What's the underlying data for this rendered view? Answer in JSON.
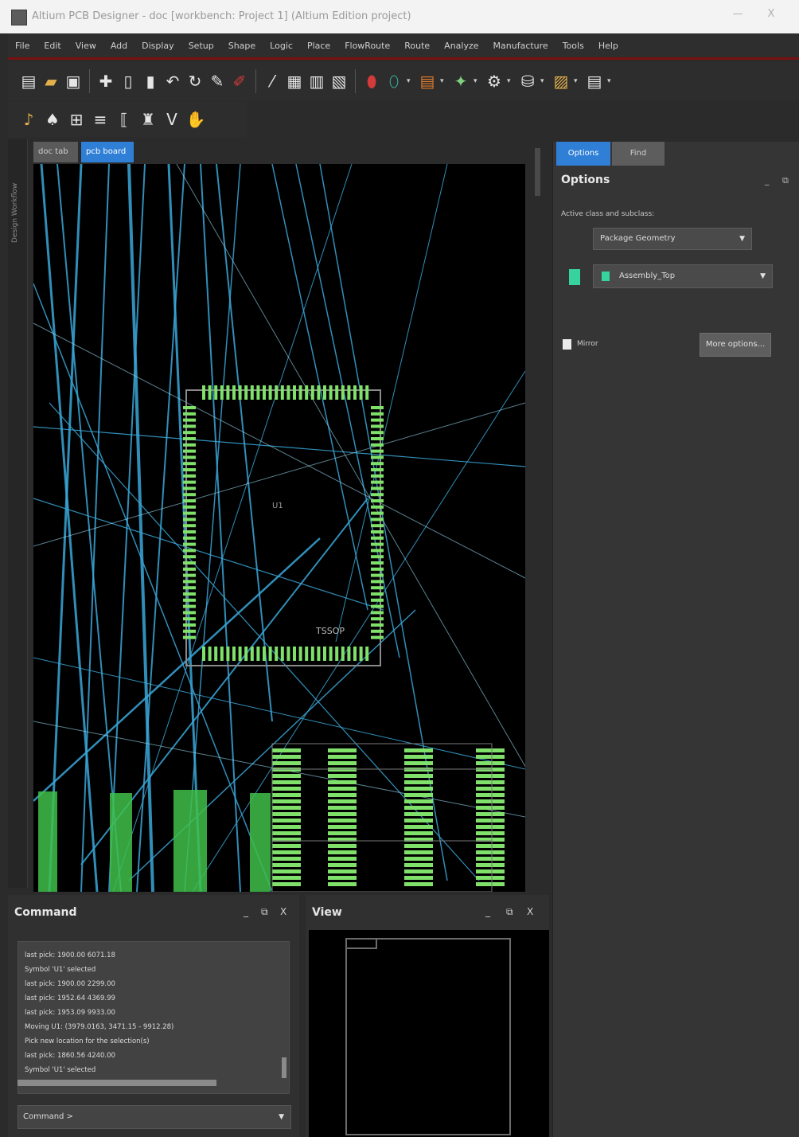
{
  "window": {
    "title": "Altium PCB Designer - doc [workbench: Project 1] (Altium Edition project)",
    "minimize": "—",
    "close": "X"
  },
  "menu": [
    "File",
    "Edit",
    "View",
    "Add",
    "Display",
    "Setup",
    "Shape",
    "Logic",
    "Place",
    "FlowRoute",
    "Route",
    "Analyze",
    "Manufacture",
    "Tools",
    "Help"
  ],
  "icons": {
    "toolbar1": [
      "new-file-icon",
      "open-folder-icon",
      "save-icon",
      "add-icon",
      "copy-icon",
      "delete-icon",
      "undo-icon",
      "redo-icon",
      "probe-icon",
      "probe2-icon",
      "route-icon",
      "component-icon",
      "library-icon",
      "footprint-icon",
      "red-net-icon",
      "teal-net-icon",
      "layer-stack-icon",
      "highlight-icon",
      "settings-gear-icon",
      "package-icon",
      "document-icon",
      "report-icon"
    ],
    "toolbar2": [
      "trace-icon",
      "pad-icon",
      "via-icon",
      "bus-icon",
      "bracket-icon",
      "trash-icon",
      "v-icon",
      "hand-icon"
    ]
  },
  "left_strip_label": "Design Workflow",
  "doc_tabs": {
    "inactive": "doc tab",
    "active": "pcb board"
  },
  "canvas": {
    "component_label": "U1",
    "ref_label": "TSSOP"
  },
  "options_panel": {
    "tabs": {
      "active": "Options",
      "inactive": "Find"
    },
    "title": "Options",
    "min": "_",
    "float": "⧉",
    "active_class_label": "Active class and subclass:",
    "class_select": "Package Geometry",
    "subclass_select": "Assembly_Top",
    "mirror_label": "Mirror",
    "more_button": "More options..."
  },
  "command_panel": {
    "title": "Command",
    "min": "_",
    "float": "⧉",
    "close": "X",
    "log": [
      "last pick:  1900.00 6071.18",
      "Symbol 'U1' selected",
      "last pick:  1900.00 2299.00",
      "last pick:  1952.64 4369.99",
      "last pick:  1953.09 9933.00",
      "Moving U1: (3979.0163, 3471.15 - 9912.28)",
      "Pick new location for the selection(s)",
      "last pick:  1860.56 4240.00",
      "Symbol 'U1' selected"
    ],
    "input_value": "Command >"
  },
  "view_panel": {
    "title": "View",
    "min": "_",
    "float": "⧉",
    "close": "X"
  }
}
